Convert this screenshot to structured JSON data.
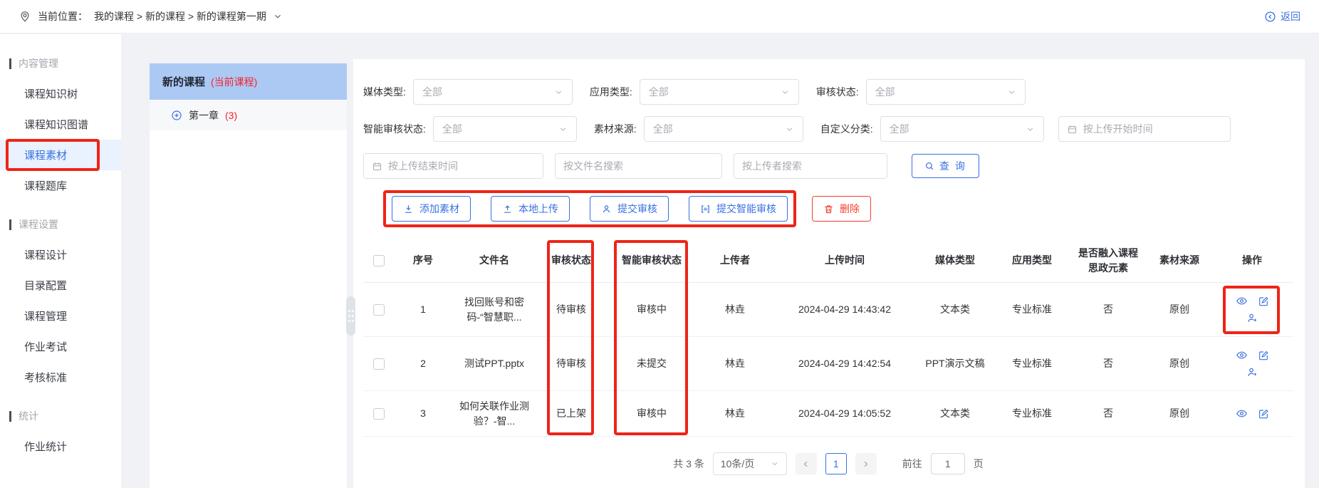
{
  "colors": {
    "accent_blue": "#3a70e2",
    "danger_red": "#f2402c",
    "annotation_red": "#ee2417",
    "tag_red": "#f5222d",
    "course_header_bg": "#abc9f3",
    "active_item_bg": "#e9f2fe"
  },
  "icons": {
    "location": "map-pin outline",
    "back": "circled left arrow",
    "expand": "circled plus",
    "calendar": "calendar outline",
    "search": "magnifier",
    "add_material": "arrow-down-to-line",
    "local_upload": "arrow-up-to-line",
    "submit_review": "person",
    "submit_ai_review": "AI in brackets",
    "delete": "trash can",
    "view": "eye",
    "edit": "pencil in square",
    "assign_reviewer": "person with plus"
  },
  "topbar": {
    "location_label": "当前位置：",
    "breadcrumb": "我的课程 > 新的课程 > 新的课程第一期",
    "back_label": "返回"
  },
  "sidebar": {
    "sections": [
      {
        "title": "内容管理",
        "items": [
          {
            "label": "课程知识树"
          },
          {
            "label": "课程知识图谱"
          },
          {
            "label": "课程素材"
          },
          {
            "label": "课程题库"
          }
        ]
      },
      {
        "title": "课程设置",
        "items": [
          {
            "label": "课程设计"
          },
          {
            "label": "目录配置"
          },
          {
            "label": "课程管理"
          },
          {
            "label": "作业考试"
          },
          {
            "label": "考核标准"
          }
        ]
      },
      {
        "title": "统计",
        "items": [
          {
            "label": "作业统计"
          }
        ]
      }
    ]
  },
  "course_tree": {
    "title": "新的课程",
    "tag": "(当前课程)",
    "chapter": "第一章",
    "count": "(3)"
  },
  "filters": {
    "media_type": {
      "label": "媒体类型:",
      "value": "全部"
    },
    "app_type": {
      "label": "应用类型:",
      "value": "全部"
    },
    "review_status": {
      "label": "审核状态:",
      "value": "全部"
    },
    "ai_status": {
      "label": "智能审核状态:",
      "value": "全部"
    },
    "source": {
      "label": "素材来源:",
      "value": "全部"
    },
    "category": {
      "label": "自定义分类:",
      "value": "全部"
    },
    "start_time_placeholder": "按上传开始时间",
    "end_time_placeholder": "按上传结束时间",
    "filename_placeholder": "按文件名搜索",
    "uploader_placeholder": "按上传者搜索",
    "search_label": "查 询"
  },
  "toolbar": {
    "add_label": "添加素材",
    "upload_label": "本地上传",
    "submit_review_label": "提交审核",
    "submit_ai_review_label": "提交智能审核",
    "delete_label": "删除"
  },
  "table": {
    "headers": [
      "序号",
      "文件名",
      "审核状态",
      "智能审核状态",
      "上传者",
      "上传时间",
      "媒体类型",
      "应用类型",
      "是否融入课程思政元素",
      "素材来源",
      "操作"
    ],
    "rows": [
      {
        "seq": "1",
        "filename": "找回账号和密码-“智慧职...",
        "review_status": "待审核",
        "ai_status": "审核中",
        "uploader": "林垚",
        "time": "2024-04-29 14:43:42",
        "media": "文本类",
        "app": "专业标准",
        "ideology": "否",
        "source": "原创"
      },
      {
        "seq": "2",
        "filename": "测试PPT.pptx",
        "review_status": "待审核",
        "ai_status": "未提交",
        "uploader": "林垚",
        "time": "2024-04-29 14:42:54",
        "media": "PPT演示文稿",
        "app": "专业标准",
        "ideology": "否",
        "source": "原创"
      },
      {
        "seq": "3",
        "filename": "如何关联作业测验？-智...",
        "review_status": "已上架",
        "ai_status": "审核中",
        "uploader": "林垚",
        "time": "2024-04-29 14:05:52",
        "media": "文本类",
        "app": "专业标准",
        "ideology": "否",
        "source": "原创"
      }
    ]
  },
  "pagination": {
    "total": "共 3 条",
    "page_size": "10条/页",
    "current_page": "1",
    "goto_label": "前往",
    "goto_value": "1",
    "page_label": "页"
  }
}
